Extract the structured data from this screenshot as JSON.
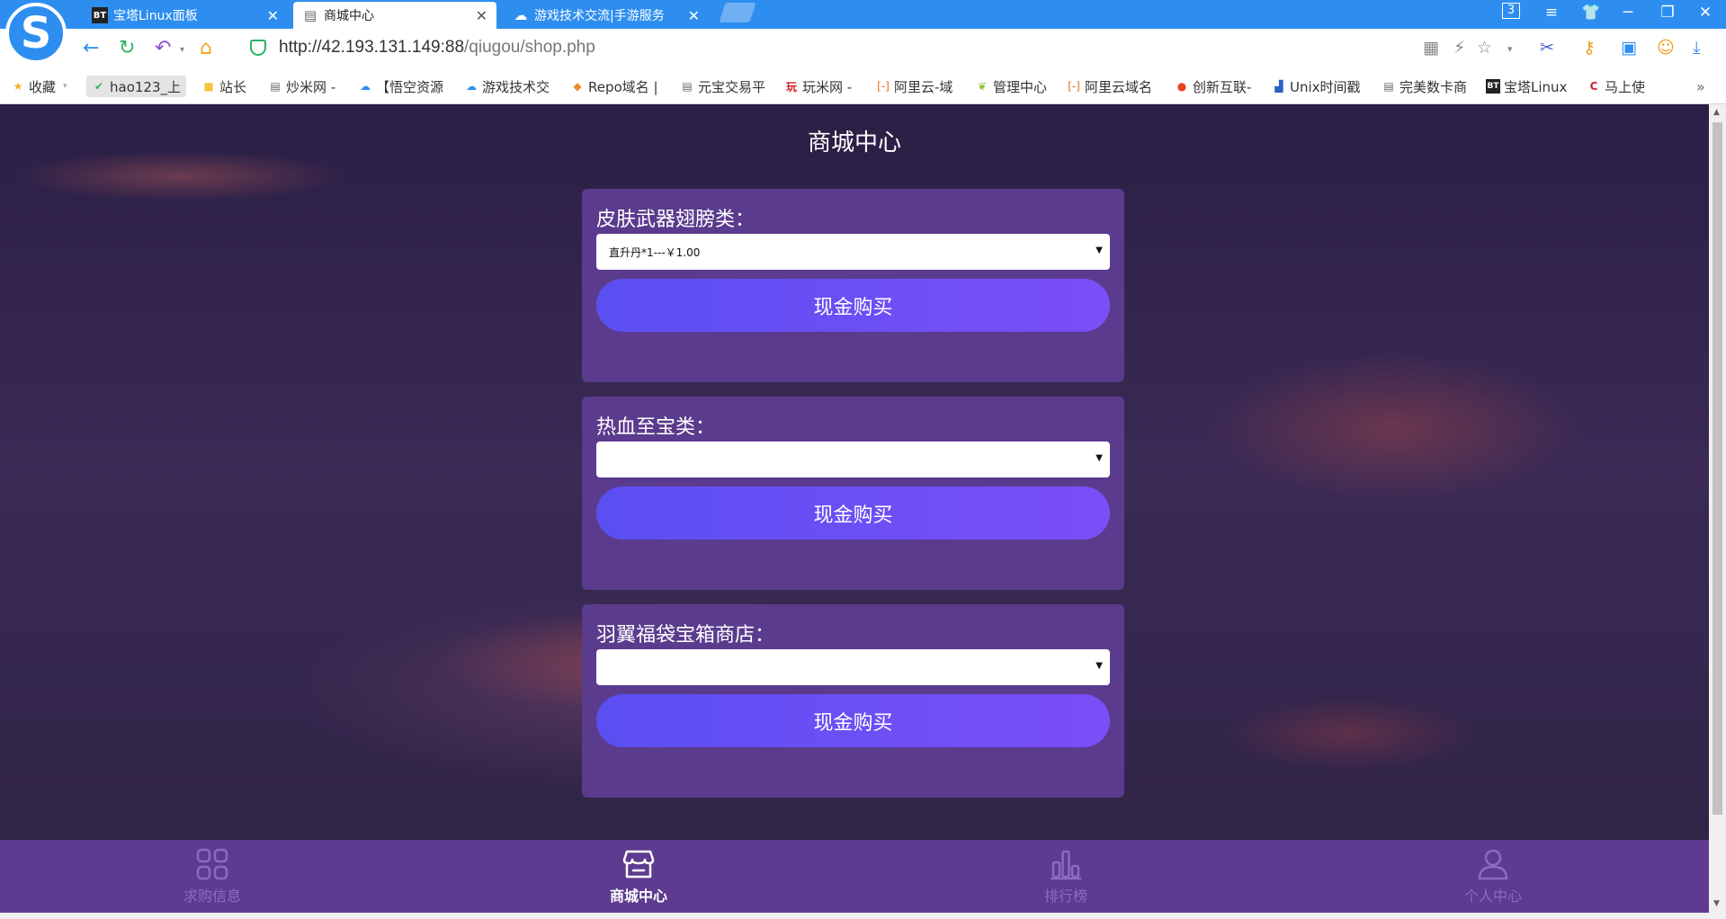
{
  "browser": {
    "tabs": [
      {
        "favicon": "BT",
        "title": "宝塔Linux面板"
      },
      {
        "favicon": "doc",
        "title": "商城中心"
      },
      {
        "favicon": "cloud",
        "title": "游戏技术交流|手游服务"
      }
    ],
    "tab_count": "3",
    "url_host": "http://42.193.131.149:88",
    "url_path": "/qiugou/shop.php"
  },
  "bookmarks": [
    {
      "icon": "star",
      "label": "收藏"
    },
    {
      "icon": "hao",
      "label": "hao123_上"
    },
    {
      "icon": "folder",
      "label": "站长"
    },
    {
      "icon": "doc",
      "label": "炒米网 -"
    },
    {
      "icon": "cloud",
      "label": "【悟空资源"
    },
    {
      "icon": "cloud",
      "label": "游戏技术交"
    },
    {
      "icon": "repo",
      "label": "Repo域名 |"
    },
    {
      "icon": "doc",
      "label": "元宝交易平"
    },
    {
      "icon": "wan",
      "label": "玩米网 -"
    },
    {
      "icon": "aliyun",
      "label": "阿里云-域"
    },
    {
      "icon": "leaf",
      "label": "管理中心"
    },
    {
      "icon": "aliyun",
      "label": "阿里云域名"
    },
    {
      "icon": "fire",
      "label": "创新互联-"
    },
    {
      "icon": "unix",
      "label": "Unix时间戳"
    },
    {
      "icon": "doc",
      "label": "完美数卡商"
    },
    {
      "icon": "BT",
      "label": "宝塔Linux"
    },
    {
      "icon": "C",
      "label": "马上使"
    }
  ],
  "page": {
    "title": "商城中心",
    "cards": [
      {
        "label": "皮肤武器翅膀类：",
        "selected": "直升丹*1---￥1.00",
        "button": "现金购买"
      },
      {
        "label": "热血至宝类：",
        "selected": "",
        "button": "现金购买"
      },
      {
        "label": "羽翼福袋宝箱商店：",
        "selected": "",
        "button": "现金购买"
      }
    ]
  },
  "bottom_nav": [
    {
      "icon": "grid-icon",
      "label": "求购信息",
      "active": false
    },
    {
      "icon": "store-icon",
      "label": "商城中心",
      "active": true
    },
    {
      "icon": "bar-chart-icon",
      "label": "排行榜",
      "active": false
    },
    {
      "icon": "user-icon",
      "label": "个人中心",
      "active": false
    }
  ]
}
